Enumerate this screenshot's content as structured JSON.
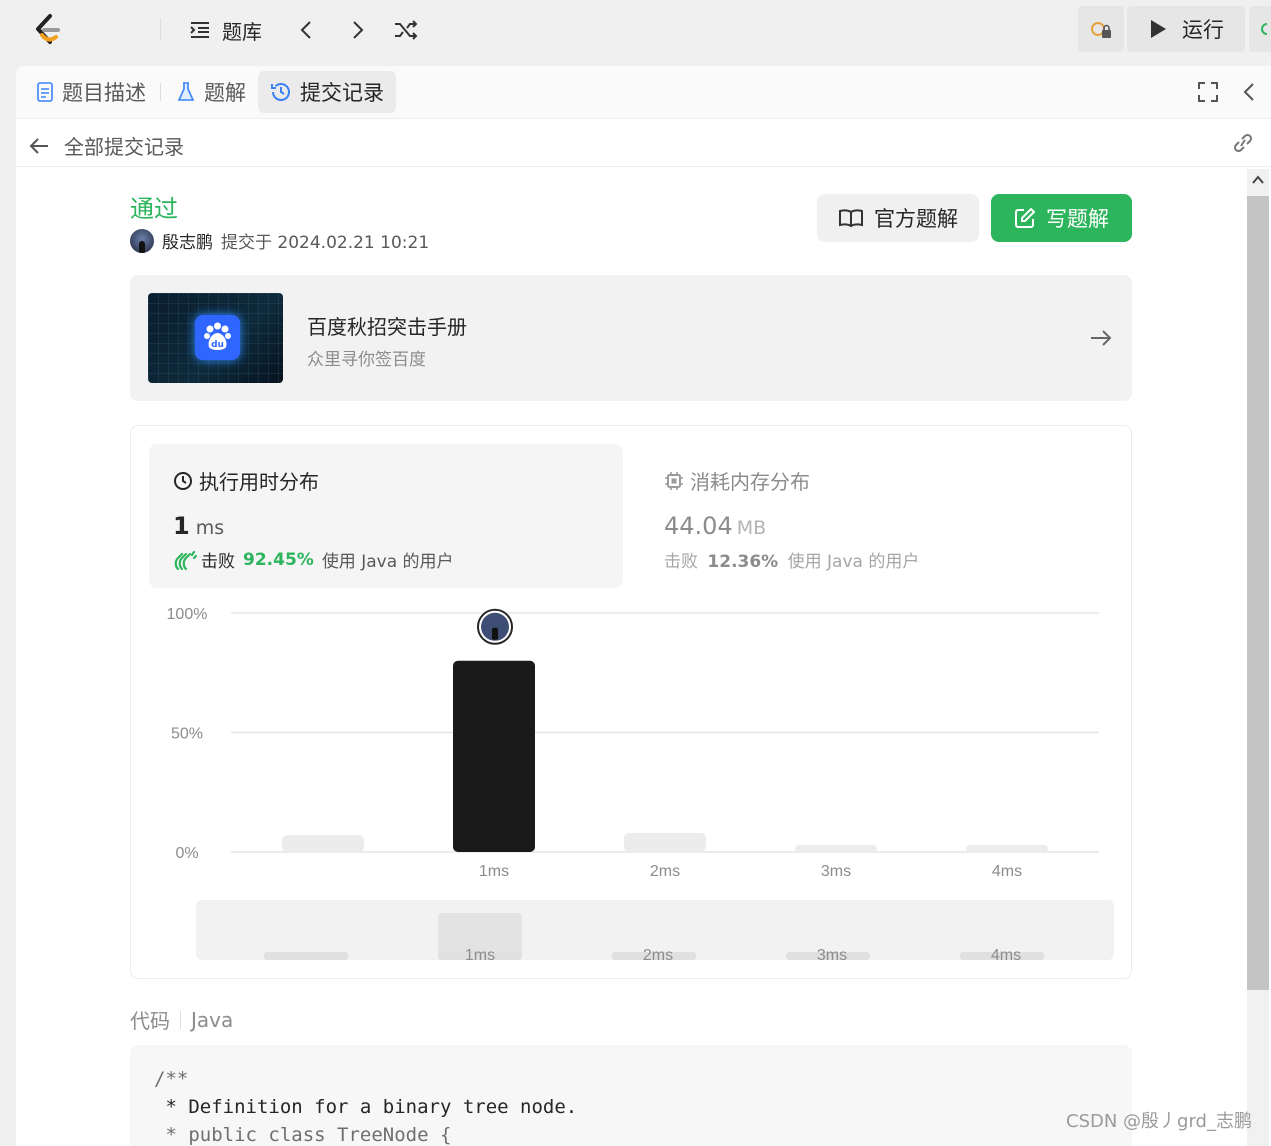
{
  "topbar": {
    "library_label": "题库",
    "run_label": "运行"
  },
  "tabs": [
    {
      "label": "题目描述"
    },
    {
      "label": "题解"
    },
    {
      "label": "提交记录"
    }
  ],
  "subbar": {
    "back_label": "全部提交记录"
  },
  "submission": {
    "status": "通过",
    "author": "殷志鹏",
    "submitted_at": "提交于 2024.02.21 10:21",
    "official_solution_label": "官方题解",
    "write_solution_label": "写题解"
  },
  "promo": {
    "title": "百度秋招突击手册",
    "subtitle": "众里寻你签百度"
  },
  "runtime": {
    "title": "执行用时分布",
    "value": "1",
    "unit": "ms",
    "beat_prefix": "击败",
    "beat_pct": "92.45%",
    "beat_suffix": "使用 Java 的用户"
  },
  "memory": {
    "title": "消耗内存分布",
    "value": "44.04",
    "unit": "MB",
    "beat_prefix": "击败",
    "beat_pct": "12.36%",
    "beat_suffix": "使用 Java 的用户"
  },
  "chart_data": {
    "type": "bar",
    "categories": [
      "",
      "1ms",
      "2ms",
      "3ms",
      "4ms"
    ],
    "values": [
      7,
      80,
      8,
      3,
      3
    ],
    "highlight_index": 1,
    "yticks": [
      "100%",
      "50%",
      "0%"
    ],
    "ylim": [
      0,
      100
    ],
    "overview_categories": [
      "",
      "1ms",
      "2ms",
      "3ms",
      "4ms"
    ],
    "colors": {
      "highlight": "#1a1a1a",
      "bar": "#ececec",
      "grid": "#e6e6e6"
    }
  },
  "code": {
    "section_label": "代码",
    "language": "Java",
    "lines": [
      "/**",
      " * Definition for a binary tree node.",
      " * public class TreeNode {"
    ]
  },
  "watermark": "CSDN @殷丿grd_志鹏"
}
